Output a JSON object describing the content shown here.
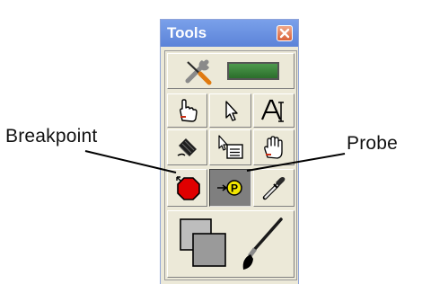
{
  "palette": {
    "title": "Tools",
    "close_icon": "close-icon",
    "selected_tool": "probe-tool",
    "tools": [
      "automatic-tool-selection",
      "operate-value",
      "position-size-select",
      "edit-text",
      "connect-wire",
      "object-shortcut-menu",
      "scroll-window",
      "set-clear-breakpoint",
      "probe-data",
      "get-color",
      "set-color"
    ]
  },
  "callouts": {
    "breakpoint": "Breakpoint",
    "probe": "Probe"
  },
  "colors": {
    "titlebar": "#6b92e0",
    "close_button": "#e36a42",
    "palette_bg": "#ece9d8",
    "selected_tool_bg": "#7f7f7f",
    "breakpoint_red": "#e00000",
    "probe_yellow": "#f2e600",
    "auto_tool_indicator": "#2b6e2b"
  }
}
